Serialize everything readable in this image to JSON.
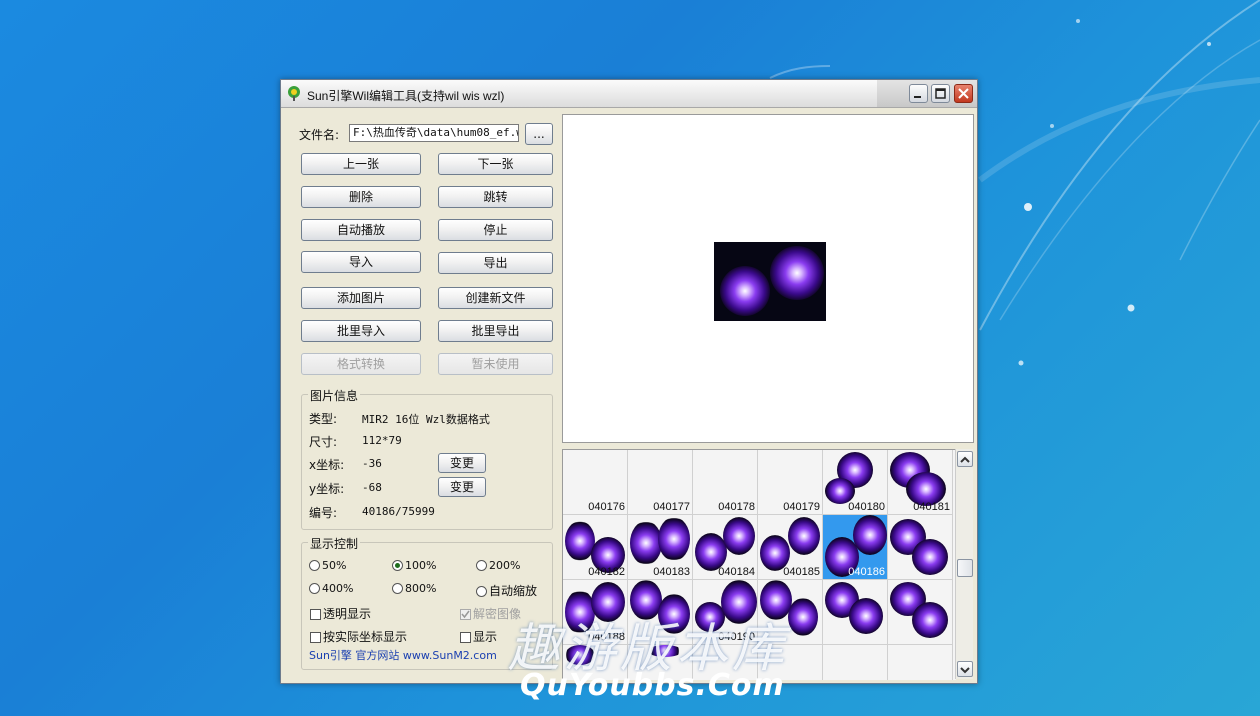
{
  "window": {
    "title": "Sun引擎Wil编辑工具(支持wil wis wzl)",
    "min_icon": "minimize-icon",
    "max_icon": "maximize-icon",
    "close_icon": "close-icon"
  },
  "file": {
    "label": "文件名:",
    "path": "F:\\热血传奇\\data\\hum08_ef.w:",
    "browse_label": "..."
  },
  "buttons": {
    "prev": "上一张",
    "next": "下一张",
    "delete": "删除",
    "jump": "跳转",
    "autoplay": "自动播放",
    "stop": "停止",
    "import": "导入",
    "export": "导出",
    "add_image": "添加图片",
    "create_file": "创建新文件",
    "batch_import": "批里导入",
    "batch_export": "批里导出",
    "convert": "格式转换",
    "unused": "暂未使用"
  },
  "info": {
    "title": "图片信息",
    "type_label": "类型:",
    "type_value": "MIR2 16位 Wzl数据格式",
    "size_label": "尺寸:",
    "size_value": "112*79",
    "x_label": "x坐标:",
    "x_value": "-36",
    "y_label": "y坐标:",
    "y_value": "-68",
    "id_label": "编号:",
    "id_value": "40186/75999",
    "change": "变更"
  },
  "display": {
    "title": "显示控制",
    "zoom": [
      "50%",
      "100%",
      "200%",
      "400%",
      "800%",
      "自动缩放"
    ],
    "selected_zoom": "100%",
    "transparent": "透明显示",
    "decrypt": "解密图像",
    "actual_coords": "按实际坐标显示",
    "show_other": "显示"
  },
  "footer": {
    "site": "Sun引擎 官方网站 www.SunM2.com"
  },
  "thumbs": {
    "row1": [
      "040176",
      "040177",
      "040178",
      "040179",
      "040180",
      "040181"
    ],
    "row2": [
      "040182",
      "040183",
      "040184",
      "040185",
      "040186",
      ""
    ],
    "row3": [
      "040188",
      "",
      "040190",
      "",
      "",
      ""
    ],
    "selected": "040186"
  },
  "watermark": {
    "cn": "趣游版本库",
    "en": "QuYoubbs.Com"
  },
  "colors": {
    "accent_selected": "#3399ee",
    "link": "#1a3fb0"
  }
}
